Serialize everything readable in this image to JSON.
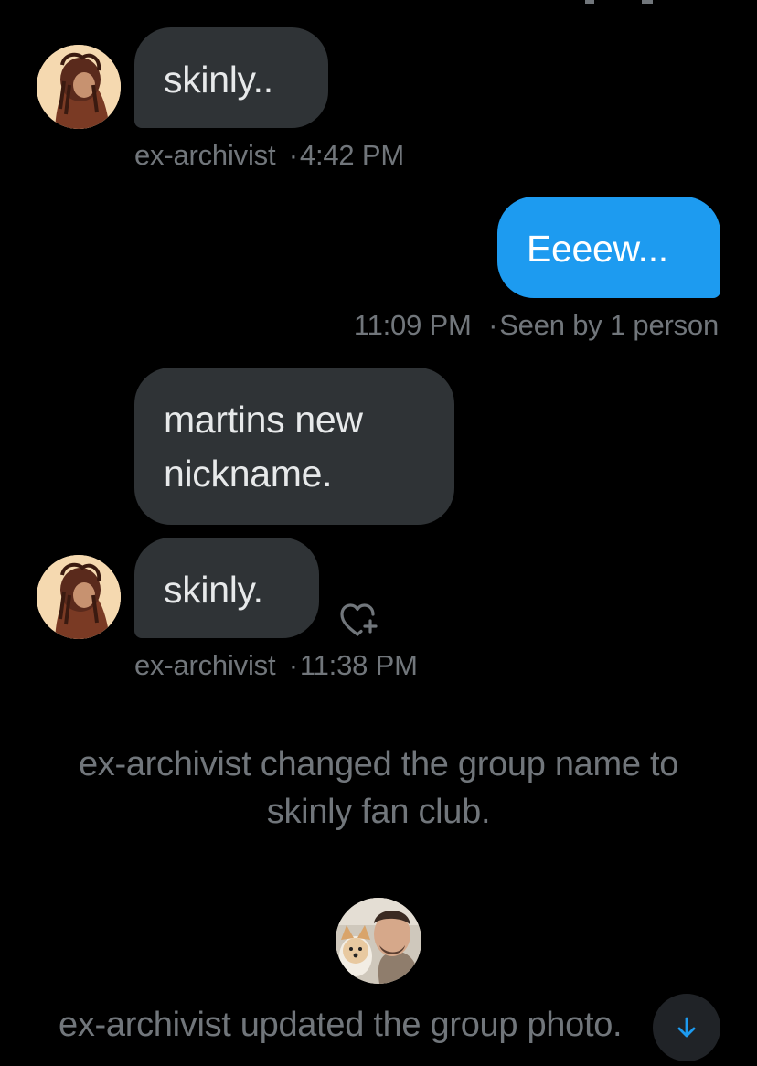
{
  "messages": [
    {
      "text": "skinly..",
      "sender": "ex-archivist",
      "time": "4:42 PM"
    },
    {
      "text": "Eeeew...",
      "time": "11:09 PM",
      "status": "Seen by 1 person"
    },
    {
      "text_line1": "martins new",
      "text_line2": "nickname."
    },
    {
      "text": "skinly.",
      "sender": "ex-archivist",
      "time": "11:38 PM"
    }
  ],
  "separator": "·",
  "system": {
    "rename_line1": "ex-archivist changed the group name to",
    "rename_line2": "skinly fan club.",
    "photo_update": "ex-archivist updated the group photo."
  },
  "icons": {
    "react": "heart-plus-icon",
    "scroll": "arrow-down-icon"
  },
  "colors": {
    "background": "#000000",
    "incoming_bubble": "#2f3336",
    "outgoing_bubble": "#1d9bf0",
    "secondary_text": "#71767b",
    "accent": "#1d9bf0"
  }
}
